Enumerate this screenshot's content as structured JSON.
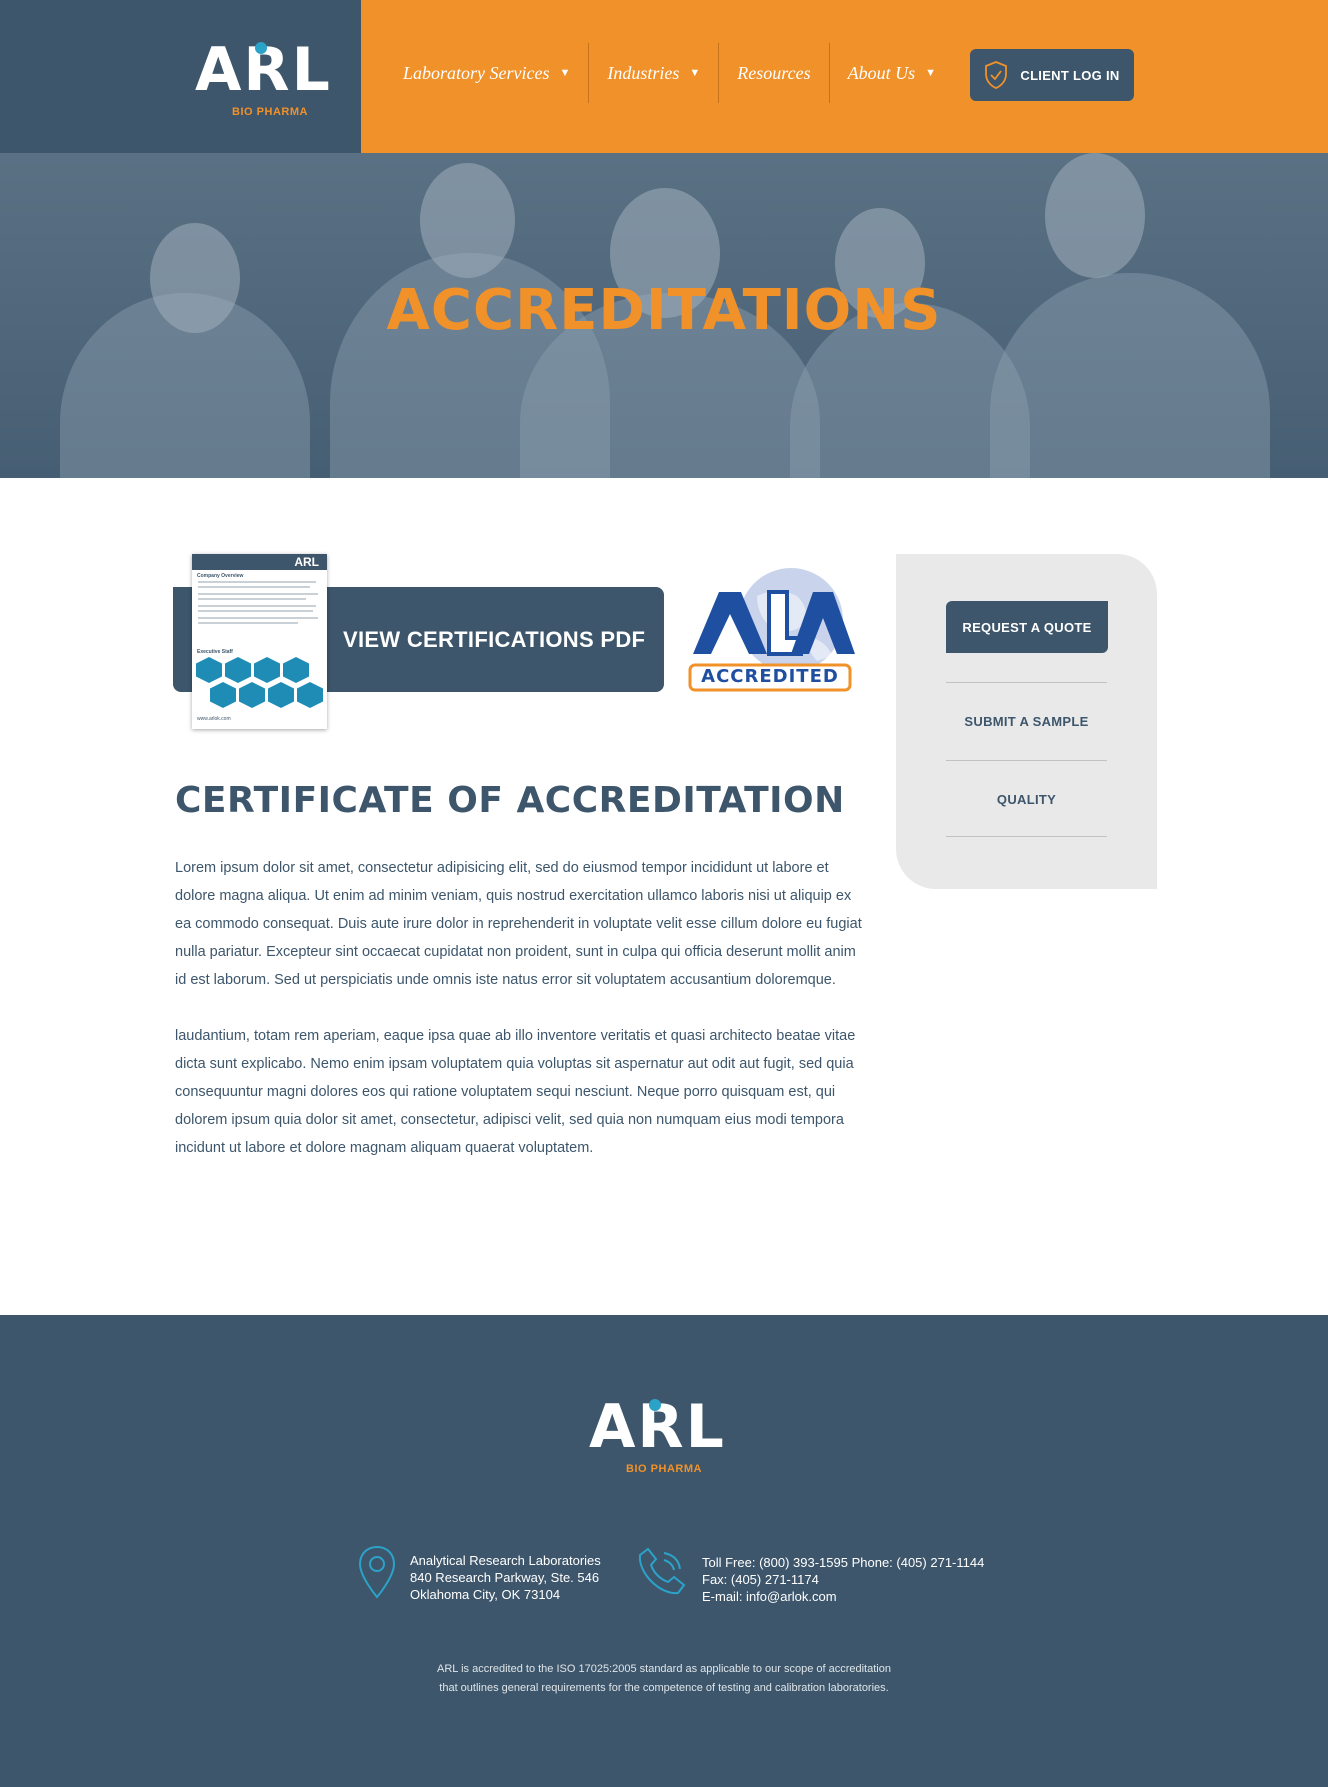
{
  "brand": {
    "logo_text": "ARL",
    "logo_sub": "BIO PHARMA",
    "colors": {
      "navy": "#3d566b",
      "orange": "#f0912a",
      "teal": "#2ba3c8"
    }
  },
  "nav": {
    "items": [
      {
        "label": "Laboratory Services",
        "has_dropdown": true
      },
      {
        "label": "Industries",
        "has_dropdown": true
      },
      {
        "label": "Resources",
        "has_dropdown": false
      },
      {
        "label": "About Us",
        "has_dropdown": true
      }
    ],
    "dropdown_icon": "chevron-down-icon",
    "login": {
      "label": "CLIENT LOG IN",
      "icon": "shield-check-icon"
    }
  },
  "hero": {
    "title": "ACCREDITATIONS"
  },
  "pdf": {
    "label": "VIEW CERTIFICATIONS PDF",
    "thumb_logo": "ARL",
    "thumb_heading": "Company Overview",
    "thumb_staff": "Executive Staff",
    "thumb_url": "www.arlok.com"
  },
  "badge": {
    "text": "ACCREDITED",
    "mark": "A2LA"
  },
  "content": {
    "title": "CERTIFICATE OF ACCREDITATION",
    "paragraph1": "Lorem ipsum dolor sit amet, consectetur adipisicing elit, sed do eiusmod tempor incididunt ut labore et dolore magna aliqua. Ut enim ad minim veniam, quis nostrud exercitation ullamco laboris nisi ut aliquip ex ea commodo consequat. Duis aute irure dolor in reprehenderit in voluptate velit esse cillum dolore eu fugiat nulla pariatur. Excepteur sint occaecat cupidatat non proident, sunt in culpa qui officia deserunt mollit anim id est laborum. Sed ut perspiciatis unde omnis iste natus error sit voluptatem accusantium doloremque.",
    "paragraph2": "laudantium, totam rem aperiam, eaque ipsa quae ab illo inventore veritatis et quasi architecto beatae vitae dicta sunt explicabo. Nemo enim ipsam voluptatem quia voluptas sit aspernatur aut odit aut fugit, sed quia consequuntur magni dolores eos qui ratione voluptatem sequi nesciunt. Neque porro quisquam est, qui dolorem ipsum quia dolor sit amet, consectetur, adipisci velit, sed quia non numquam eius modi tempora incidunt ut labore et dolore magnam aliquam quaerat voluptatem."
  },
  "sidebar": {
    "quote_label": "REQUEST A QUOTE",
    "links": [
      "SUBMIT A SAMPLE",
      "QUALITY"
    ]
  },
  "footer": {
    "address": {
      "icon": "map-pin-icon",
      "name": "Analytical Research Laboratories",
      "street": "840 Research Parkway, Ste. 546",
      "city": "Oklahoma City, OK 73104"
    },
    "phone": {
      "icon": "phone-icon",
      "line1": "Toll Free: (800) 393-1595 Phone: (405) 271-1144",
      "line2": "Fax: (405) 271-1174",
      "line3": "E-mail: info@arlok.com"
    },
    "note_line1": "ARL is accredited to the ISO 17025:2005 standard as applicable to our scope of accreditation",
    "note_line2": "that outlines general requirements for the competence of testing and calibration laboratories."
  }
}
